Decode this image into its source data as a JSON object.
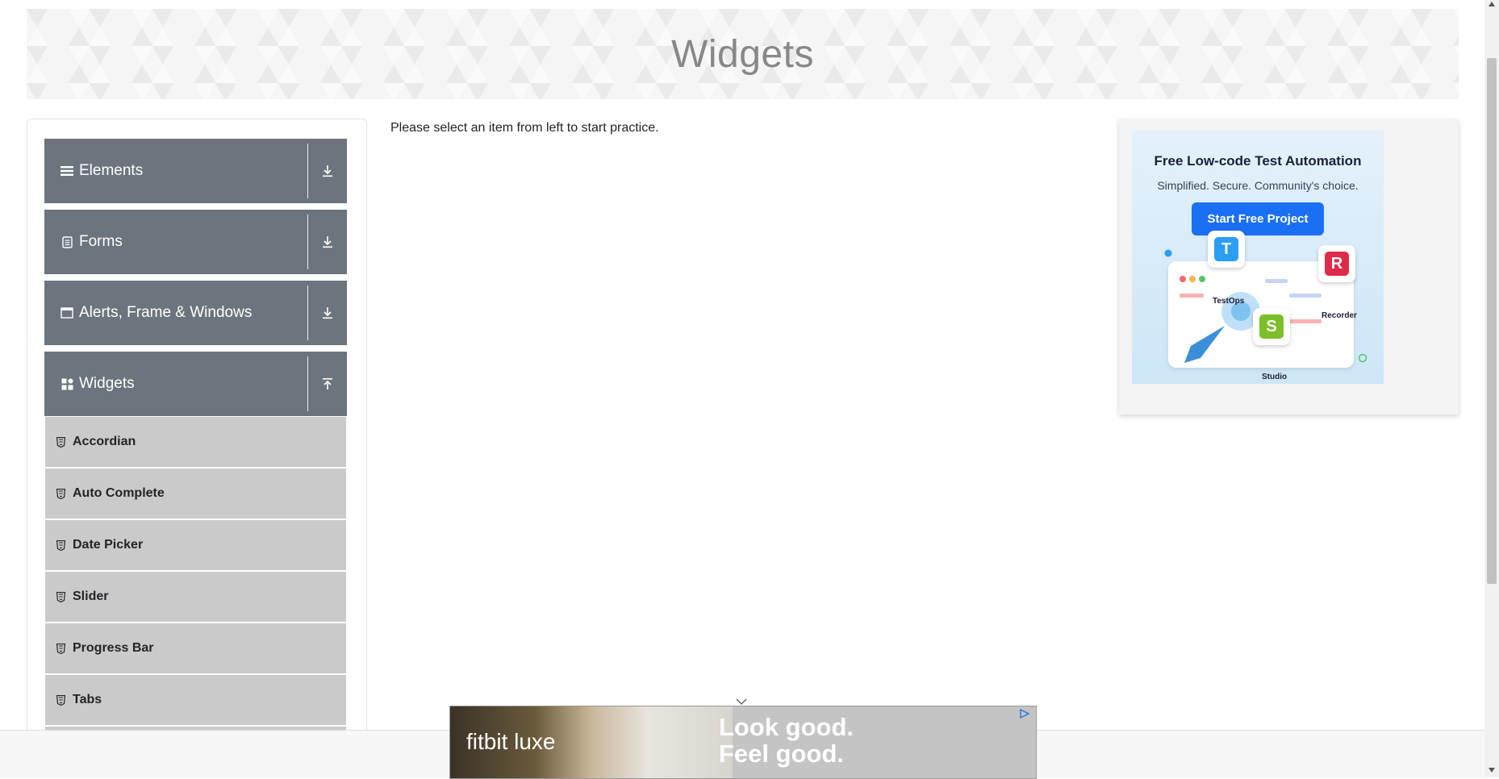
{
  "header": {
    "title": "Widgets"
  },
  "sidebar": {
    "groups": [
      {
        "label": "Elements",
        "icon": "hamburger-icon",
        "expanded": false
      },
      {
        "label": "Forms",
        "icon": "document-icon",
        "expanded": false
      },
      {
        "label": "Alerts, Frame & Windows",
        "icon": "window-icon",
        "expanded": false
      },
      {
        "label": "Widgets",
        "icon": "grid-icon",
        "expanded": true
      }
    ],
    "widget_items": [
      {
        "label": "Accordian"
      },
      {
        "label": "Auto Complete"
      },
      {
        "label": "Date Picker"
      },
      {
        "label": "Slider"
      },
      {
        "label": "Progress Bar"
      },
      {
        "label": "Tabs"
      }
    ]
  },
  "main": {
    "message": "Please select an item from left to start practice."
  },
  "side_ad": {
    "title": "Free Low-code Test Automation",
    "subtitle": "Simplified. Secure. Community's choice.",
    "button": "Start Free Project",
    "labels": {
      "testops": "TestOps",
      "recorder": "Recorder",
      "studio": "Studio"
    },
    "tile_letters": {
      "testops": "T",
      "recorder": "R",
      "studio": "S"
    }
  },
  "bottom_ad": {
    "brand": "fitbit luxe",
    "tagline_1": "Look good.",
    "tagline_2": "Feel good."
  },
  "colors": {
    "sidebar_group": "#6c757d",
    "sidebar_item": "#cacaca",
    "ad_button": "#1a6ff5"
  }
}
